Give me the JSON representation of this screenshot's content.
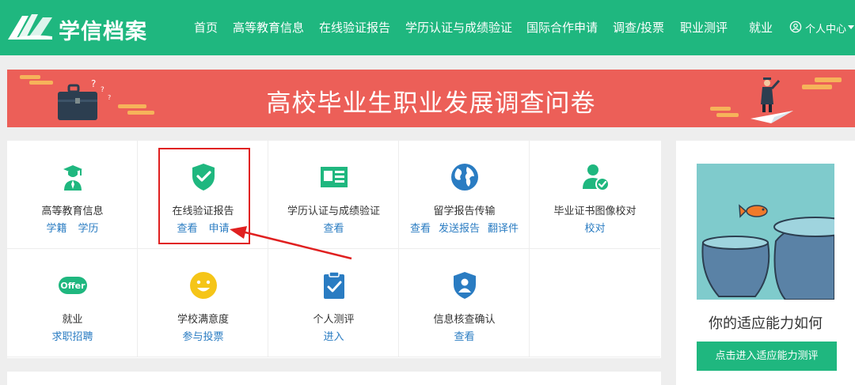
{
  "header": {
    "brand": "学信档案",
    "nav": [
      "首页",
      "高等教育信息",
      "在线验证报告",
      "学历认证与成绩验证",
      "国际合作申请",
      "调查/投票",
      "职业测评",
      "就业"
    ],
    "user_menu": "个人中心"
  },
  "banner": {
    "title": "高校毕业生职业发展调查问卷"
  },
  "services": [
    {
      "title": "高等教育信息",
      "icon": "graduate-icon",
      "links": [
        "学籍",
        "学历"
      ]
    },
    {
      "title": "在线验证报告",
      "icon": "shield-check-icon",
      "links": [
        "查看",
        "申请"
      ]
    },
    {
      "title": "学历认证与成绩验证",
      "icon": "id-card-icon",
      "links": [
        "查看"
      ]
    },
    {
      "title": "留学报告传输",
      "icon": "globe-icon",
      "links": [
        "查看",
        "发送报告",
        "翻译件"
      ]
    },
    {
      "title": "毕业证书图像校对",
      "icon": "user-check-icon",
      "links": [
        "校对"
      ]
    },
    {
      "title": "就业",
      "icon": "offer-icon",
      "links": [
        "求职招聘"
      ]
    },
    {
      "title": "学校满意度",
      "icon": "smiley-icon",
      "links": [
        "参与投票"
      ]
    },
    {
      "title": "个人测评",
      "icon": "clipboard-check-icon",
      "links": [
        "进入"
      ]
    },
    {
      "title": "信息核查确认",
      "icon": "user-shield-icon",
      "links": [
        "查看"
      ]
    }
  ],
  "offer_badge": "Offer",
  "side_card": {
    "title": "你的适应能力如何",
    "button": "点击进入适应能力测评"
  },
  "colors": {
    "brand_green": "#1fb77f",
    "banner_red": "#ec5f58",
    "link_blue": "#2a7cc2",
    "annotation_red": "#e02020"
  }
}
